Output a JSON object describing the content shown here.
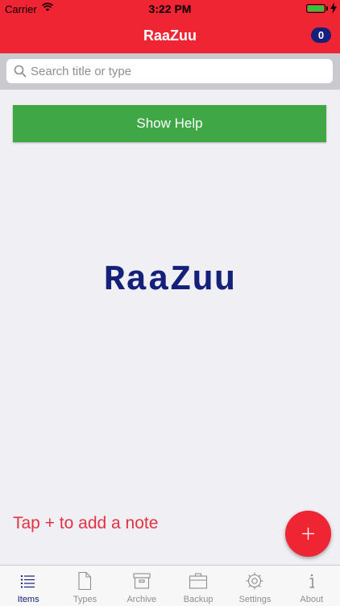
{
  "status_bar": {
    "carrier": "Carrier",
    "time": "3:22 PM"
  },
  "nav": {
    "title": "RaaZuu",
    "badge_count": "0"
  },
  "search": {
    "placeholder": "Search title or type",
    "value": ""
  },
  "help_button": {
    "label": "Show Help"
  },
  "logo": {
    "text": "RaaZuu"
  },
  "empty_hint": {
    "text": "Tap + to add a note"
  },
  "fab": {
    "icon": "plus-icon"
  },
  "tabs": [
    {
      "label": "Items",
      "icon": "list-icon",
      "active": true
    },
    {
      "label": "Types",
      "icon": "document-icon",
      "active": false
    },
    {
      "label": "Archive",
      "icon": "archive-box-icon",
      "active": false
    },
    {
      "label": "Backup",
      "icon": "briefcase-icon",
      "active": false
    },
    {
      "label": "Settings",
      "icon": "gear-icon",
      "active": false
    },
    {
      "label": "About",
      "icon": "info-icon",
      "active": false
    }
  ],
  "colors": {
    "brand_red": "#f02533",
    "navy": "#15207b",
    "help_green": "#3fa845",
    "hint_red": "#e33343"
  }
}
